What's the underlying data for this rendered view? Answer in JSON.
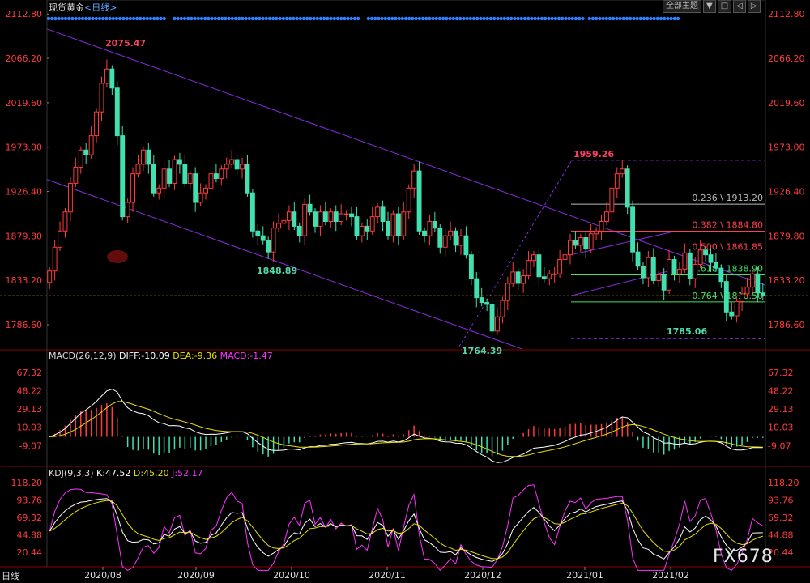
{
  "header": {
    "instrument": "现货黄金",
    "period": "<日线>",
    "theme_button": "全部主题",
    "btn_menu": "▼",
    "btn_close": "□",
    "btn_left": "◁",
    "btn_right": "▷"
  },
  "footer": {
    "period_label": "日线",
    "watermark": "FX678"
  },
  "chart_data": [
    {
      "type": "candlestick",
      "name": "price",
      "yticks": [
        "2112.80",
        "2066.20",
        "2019.60",
        "1973.00",
        "1926.40",
        "1879.80",
        "1833.20",
        "1786.60"
      ],
      "ylim": [
        1762,
        2113
      ],
      "xticks": [
        "2020/08",
        "2020/09",
        "2020/10",
        "2020/11",
        "2020/12",
        "2021/01",
        "2021/02"
      ],
      "annotations": [
        {
          "label": "2075.47",
          "value": 2075.47,
          "color": "#ff4060"
        },
        {
          "label": "1848.89",
          "value": 1848.89,
          "color": "#50d8a8"
        },
        {
          "label": "1764.39",
          "value": 1764.39,
          "color": "#50d8a8"
        },
        {
          "label": "1959.26",
          "value": 1959.26,
          "color": "#ff4060"
        },
        {
          "label": "1785.06",
          "value": 1785.06,
          "color": "#50d8a8"
        }
      ],
      "fibonacci": [
        {
          "label": "0.236 \\ 1913.20",
          "value": 1913.2,
          "color": "#bbbbbb"
        },
        {
          "label": "0.382 \\ 1884.80",
          "value": 1884.8,
          "color": "#ff4050"
        },
        {
          "label": "0.500 \\ 1861.85",
          "value": 1861.85,
          "color": "#ff4050"
        },
        {
          "label": "0.618 \\ 1838.90",
          "value": 1838.9,
          "color": "#40e060"
        },
        {
          "label": "0.764 \\ 1810.50",
          "value": 1810.5,
          "color": "#40e060"
        }
      ],
      "current_price_line": 1817,
      "closes": [
        1843,
        1868,
        1885,
        1905,
        1935,
        1952,
        1970,
        1965,
        1985,
        2010,
        2040,
        2055,
        2035,
        1985,
        1900,
        1915,
        1945,
        1955,
        1970,
        1955,
        1925,
        1930,
        1950,
        1935,
        1960,
        1955,
        1935,
        1945,
        1915,
        1925,
        1930,
        1945,
        1940,
        1950,
        1955,
        1960,
        1950,
        1955,
        1925,
        1885,
        1880,
        1875,
        1863,
        1888,
        1893,
        1896,
        1905,
        1890,
        1880,
        1913,
        1905,
        1890,
        1905,
        1895,
        1905,
        1895,
        1903,
        1903,
        1900,
        1880,
        1890,
        1885,
        1900,
        1910,
        1895,
        1880,
        1903,
        1880,
        1905,
        1930,
        1948,
        1885,
        1880,
        1895,
        1888,
        1868,
        1880,
        1885,
        1870,
        1880,
        1860,
        1835,
        1815,
        1810,
        1808,
        1780,
        1795,
        1812,
        1830,
        1842,
        1830,
        1838,
        1854,
        1860,
        1837,
        1835,
        1840,
        1840,
        1855,
        1860,
        1875,
        1870,
        1878,
        1866,
        1882,
        1885,
        1895,
        1905,
        1930,
        1945,
        1950,
        1910,
        1863,
        1848,
        1836,
        1857,
        1833,
        1839,
        1823,
        1855,
        1840,
        1845,
        1862,
        1835,
        1850,
        1865,
        1860,
        1852,
        1846,
        1832,
        1800,
        1796,
        1811,
        1819,
        1826,
        1840,
        1820,
        1817
      ],
      "macd": {
        "title": "MACD(26,12,9)",
        "diff_label": "DIFF:-10.09",
        "dea_label": "DEA:-9.36",
        "macd_label": "MACD:-1.47",
        "yticks": [
          "67.32",
          "48.22",
          "29.13",
          "10.03",
          "-9.07"
        ],
        "ylim": [
          -30,
          80
        ]
      },
      "kdj": {
        "title": "KDJ(9,3,3)",
        "k_label": "K:47.52",
        "d_label": "D:45.20",
        "j_label": "J:52.17",
        "yticks": [
          "118.20",
          "93.76",
          "69.32",
          "44.88",
          "20.44"
        ],
        "ylim": [
          0,
          125
        ]
      }
    }
  ],
  "colors": {
    "up": "#ff3c3c",
    "down": "#40e0b0",
    "channel": "#8a2be2",
    "axis_text": "#ff3c3c",
    "diff": "#ffffff",
    "dea": "#e8e000",
    "j_line": "#ff30ff"
  }
}
